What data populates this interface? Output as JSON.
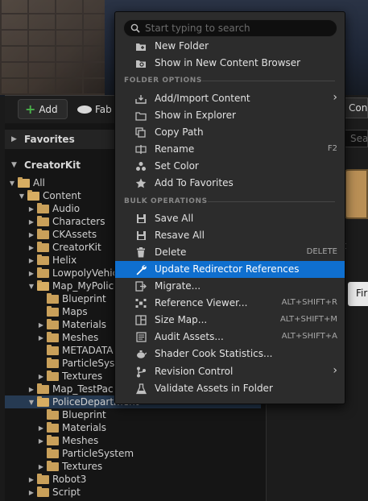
{
  "toolbar": {
    "add_label": "Add",
    "fab_label": "Fab"
  },
  "sidebar": {
    "favorites_label": "Favorites",
    "collection_label": "CreatorKit"
  },
  "tree": [
    {
      "label": "All",
      "depth": 0,
      "expanded": true,
      "selected": false
    },
    {
      "label": "Content",
      "depth": 1,
      "expanded": true,
      "selected": false
    },
    {
      "label": "Audio",
      "depth": 2,
      "expanded": false,
      "selected": false
    },
    {
      "label": "Characters",
      "depth": 2,
      "expanded": false,
      "selected": false
    },
    {
      "label": "CKAssets",
      "depth": 2,
      "expanded": false,
      "selected": false
    },
    {
      "label": "CreatorKit",
      "depth": 2,
      "expanded": false,
      "selected": false
    },
    {
      "label": "Helix",
      "depth": 2,
      "expanded": false,
      "selected": false
    },
    {
      "label": "LowpolyVehic",
      "depth": 2,
      "expanded": false,
      "selected": false
    },
    {
      "label": "Map_MyPolice",
      "depth": 2,
      "expanded": true,
      "selected": false
    },
    {
      "label": "Blueprint",
      "depth": 3,
      "expanded": null,
      "selected": false
    },
    {
      "label": "Maps",
      "depth": 3,
      "expanded": null,
      "selected": false
    },
    {
      "label": "Materials",
      "depth": 3,
      "expanded": false,
      "selected": false
    },
    {
      "label": "Meshes",
      "depth": 3,
      "expanded": false,
      "selected": false
    },
    {
      "label": "METADATA",
      "depth": 3,
      "expanded": null,
      "selected": false
    },
    {
      "label": "ParticleSyst",
      "depth": 3,
      "expanded": null,
      "selected": false
    },
    {
      "label": "Textures",
      "depth": 3,
      "expanded": false,
      "selected": false
    },
    {
      "label": "Map_TestPac",
      "depth": 2,
      "expanded": false,
      "selected": false
    },
    {
      "label": "PoliceDepartment",
      "depth": 2,
      "expanded": true,
      "selected": true
    },
    {
      "label": "Blueprint",
      "depth": 3,
      "expanded": null,
      "selected": false
    },
    {
      "label": "Materials",
      "depth": 3,
      "expanded": false,
      "selected": false
    },
    {
      "label": "Meshes",
      "depth": 3,
      "expanded": false,
      "selected": false
    },
    {
      "label": "ParticleSystem",
      "depth": 3,
      "expanded": null,
      "selected": false
    },
    {
      "label": "Textures",
      "depth": 3,
      "expanded": false,
      "selected": false
    },
    {
      "label": "Robot3",
      "depth": 2,
      "expanded": false,
      "selected": false
    },
    {
      "label": "Script",
      "depth": 2,
      "expanded": false,
      "selected": false
    }
  ],
  "right_pane": {
    "tab_label": "Con",
    "search_placeholder": "Searc",
    "btn_label": "Fir",
    "glyph": "t"
  },
  "menu": {
    "search_placeholder": "Start typing to search",
    "sections": {
      "folder_options": "FOLDER OPTIONS",
      "bulk_operations": "BULK OPERATIONS"
    },
    "items": {
      "new_folder": {
        "label": "New Folder",
        "icon": "new-folder-icon"
      },
      "show_in_new_cb": {
        "label": "Show in New Content Browser",
        "icon": "content-browser-icon"
      },
      "add_import": {
        "label": "Add/Import Content",
        "icon": "import-icon"
      },
      "show_in_explorer": {
        "label": "Show in Explorer",
        "icon": "explorer-icon"
      },
      "copy_path": {
        "label": "Copy Path",
        "icon": "copy-icon"
      },
      "rename": {
        "label": "Rename",
        "icon": "rename-icon",
        "shortcut": "F2"
      },
      "set_color": {
        "label": "Set Color",
        "icon": "palette-icon"
      },
      "add_to_favorites": {
        "label": "Add To Favorites",
        "icon": "star-icon"
      },
      "save_all": {
        "label": "Save All",
        "icon": "save-icon"
      },
      "resave_all": {
        "label": "Resave All",
        "icon": "save-icon"
      },
      "delete": {
        "label": "Delete",
        "icon": "trash-icon",
        "shortcut": "DELETE"
      },
      "update_redirector": {
        "label": "Update Redirector References",
        "icon": "wrench-icon"
      },
      "migrate": {
        "label": "Migrate...",
        "icon": "migrate-icon"
      },
      "reference_viewer": {
        "label": "Reference Viewer...",
        "icon": "reference-viewer-icon",
        "shortcut": "ALT+SHIFT+R"
      },
      "size_map": {
        "label": "Size Map...",
        "icon": "size-map-icon",
        "shortcut": "ALT+SHIFT+M"
      },
      "audit_assets": {
        "label": "Audit Assets...",
        "icon": "audit-icon",
        "shortcut": "ALT+SHIFT+A"
      },
      "shader_cook": {
        "label": "Shader Cook Statistics...",
        "icon": "teapot-icon"
      },
      "revision_control": {
        "label": "Revision Control",
        "icon": "branch-icon"
      },
      "validate_assets": {
        "label": "Validate Assets in Folder",
        "icon": "flask-icon"
      }
    }
  },
  "colors": {
    "menu_bg": "#2c2c2c",
    "highlight": "#0f6fcf",
    "folder": "#c9a05a",
    "selected_row": "#263a52",
    "add_plus": "#49b04a"
  }
}
